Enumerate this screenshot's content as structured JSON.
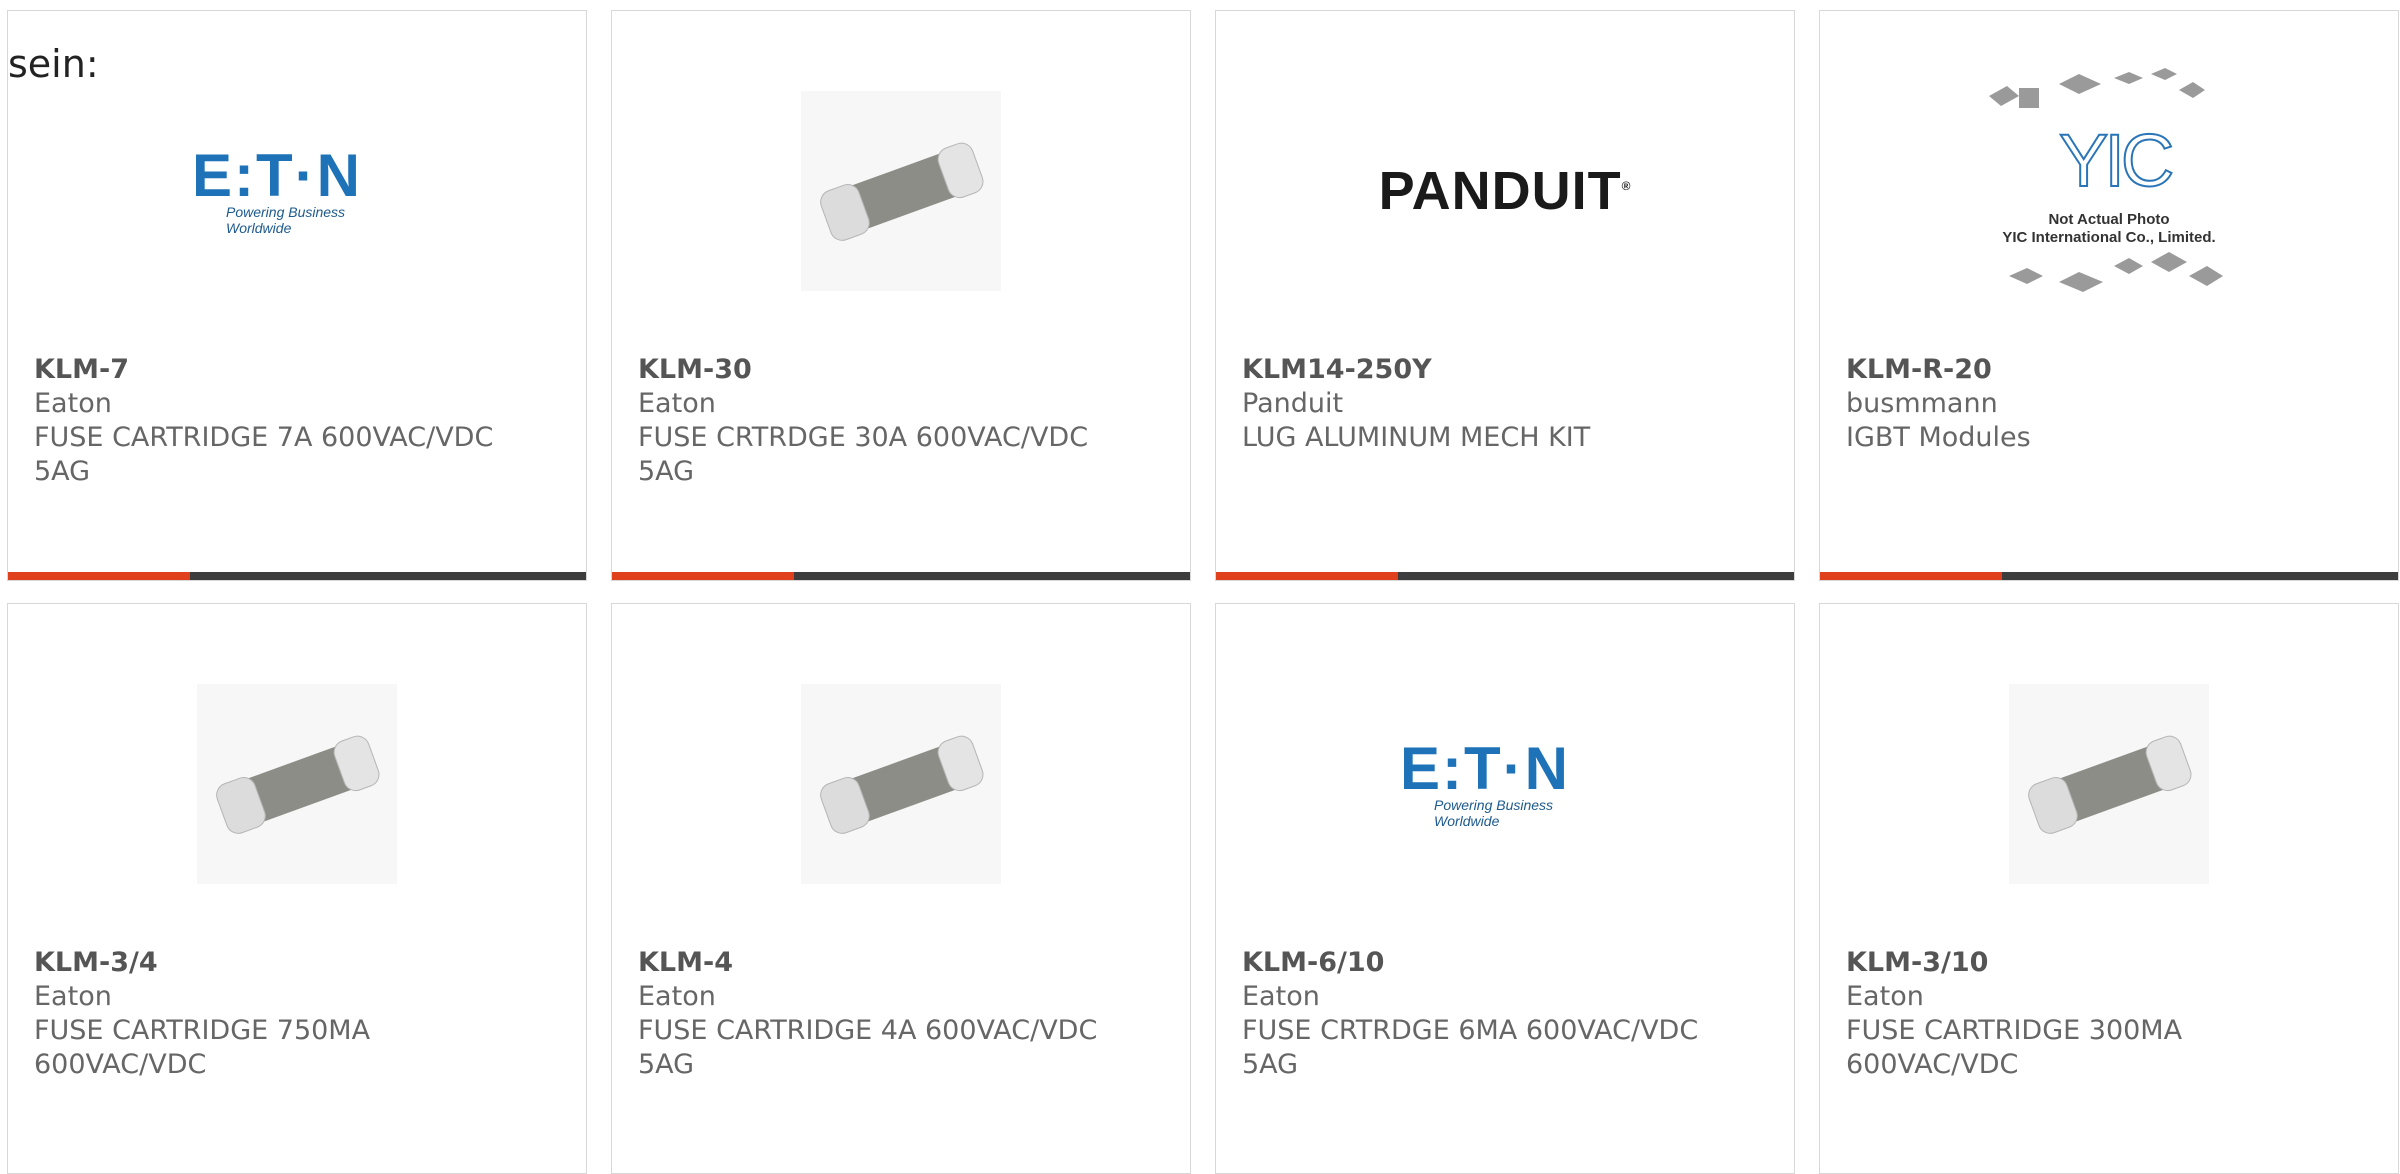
{
  "lead_text": "sein:",
  "colors": {
    "accent": "#e0401c",
    "bar": "#3d3d3d",
    "eaton_blue": "#1d72b8"
  },
  "cards": [
    {
      "part": "KLM-7",
      "manufacturer": "Eaton",
      "description": "FUSE CARTRIDGE 7A 600VAC/VDC 5AG",
      "image": "eaton-logo",
      "logo": {
        "word": "E:T·N",
        "tag": "Powering Business Worldwide"
      }
    },
    {
      "part": "KLM-30",
      "manufacturer": "Eaton",
      "description": "FUSE CRTRDGE 30A 600VAC/VDC 5AG",
      "image": "fuse-photo"
    },
    {
      "part": "KLM14-250Y",
      "manufacturer": "Panduit",
      "description": "LUG ALUMINUM MECH KIT",
      "image": "panduit-logo",
      "logo": {
        "word": "PANDUIT",
        "mark": "®"
      }
    },
    {
      "part": "KLM-R-20",
      "manufacturer": "busmmann",
      "description": "IGBT Modules",
      "image": "yic-placeholder",
      "placeholder": {
        "mark": "YIC",
        "line1": "Not Actual Photo",
        "line2": "YIC International Co., Limited."
      }
    },
    {
      "part": "KLM-3/4",
      "manufacturer": "Eaton",
      "description": "FUSE CARTRIDGE 750MA 600VAC/VDC",
      "image": "fuse-photo"
    },
    {
      "part": "KLM-4",
      "manufacturer": "Eaton",
      "description": "FUSE CARTRIDGE 4A 600VAC/VDC 5AG",
      "image": "fuse-photo"
    },
    {
      "part": "KLM-6/10",
      "manufacturer": "Eaton",
      "description": "FUSE CRTRDGE 6MA 600VAC/VDC 5AG",
      "image": "eaton-logo",
      "logo": {
        "word": "E:T·N",
        "tag": "Powering Business Worldwide"
      }
    },
    {
      "part": "KLM-3/10",
      "manufacturer": "Eaton",
      "description": "FUSE CARTRIDGE 300MA 600VAC/VDC",
      "image": "fuse-photo"
    }
  ]
}
